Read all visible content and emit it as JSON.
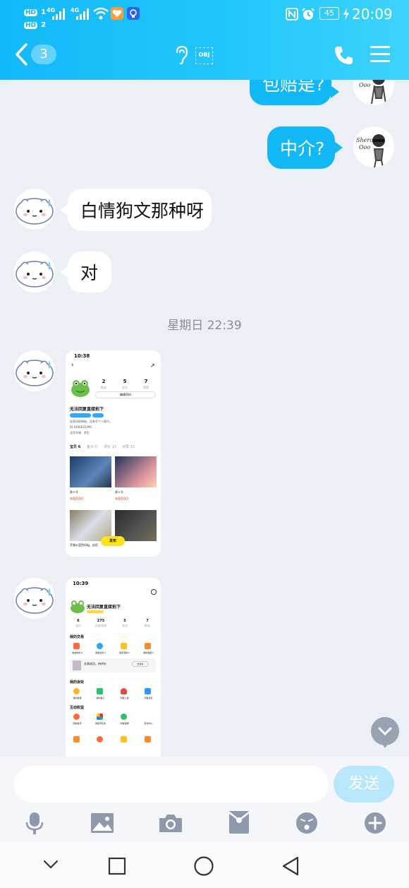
{
  "status_bar": {
    "hd1": "HD",
    "sim1": "1",
    "hd2": "HD",
    "sim2": "2",
    "net1": "4G",
    "net2": "4G",
    "battery": "45",
    "time": "20:09"
  },
  "header": {
    "unread_count": "3",
    "obj_label": "OBJ"
  },
  "messages": {
    "m1": "包赔是?",
    "m2": "中介?",
    "m3": "白情狗文那种呀",
    "m4": "对"
  },
  "timestamp": "星期日 22:39",
  "shot1": {
    "time": "10:38",
    "stat1_num": "2",
    "stat1_label": "粉丝",
    "stat2_num": "5",
    "stat2_label": "关注",
    "stat3_num": "7",
    "stat3_label": "获赞",
    "edit_label": "编辑资料",
    "name": "无法回复直接拍下",
    "desc": "这家伙很神秘，没有写个人简介。",
    "id": "ID  6466625490",
    "location": "北京东城 · 男生",
    "tabs": [
      "宝贝 6",
      "鱼子 0",
      "评价 13",
      "点赞 31"
    ],
    "item1_title": "贵十号",
    "item1_price": "¥6000",
    "item2_title": "贵十号",
    "item2_price": "¥6000",
    "item3_title": "苹果ar蓝色64g，自用",
    "publish": "发布"
  },
  "shot2": {
    "time": "10:39",
    "name": "无法回复直接拍下",
    "stats": [
      {
        "num": "6",
        "label": "宝贝"
      },
      {
        "num": "275",
        "label": "历史浏览"
      },
      {
        "num": "5",
        "label": "关注"
      },
      {
        "num": "7",
        "label": "粉丝"
      }
    ],
    "section1": "我的交易",
    "trade_items": [
      "我发布的 6",
      "我卖出的 0",
      "我买到的 0",
      "我的收藏 0"
    ],
    "banner_text": "交易成功，待评价",
    "banner_btn": "去评价",
    "section2": "我的会玩",
    "fun_items": [
      "我的鱼塘",
      "我的鱼子",
      "闲鱼公益",
      "闲鱼社区"
    ],
    "section3": "互动权益",
    "perk_items": [
      "回收鱼币",
      "闲鱼币任务",
      "闲鱼客服",
      "安全中心"
    ]
  },
  "composer": {
    "placeholder": "",
    "send_label": "发送"
  },
  "colors": {
    "header_blue": "#12b9f8",
    "bubble_out": "#12b7f5",
    "send_disabled": "#b8e6fb",
    "icon_gray": "#8e9aac"
  }
}
